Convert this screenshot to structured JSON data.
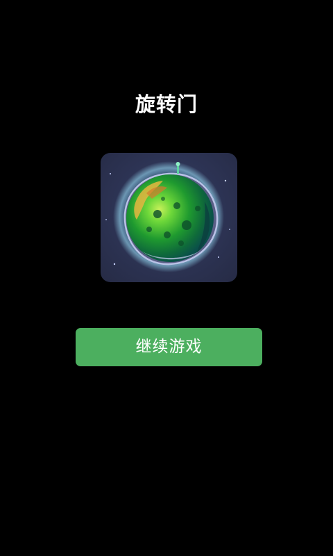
{
  "app": {
    "title": "旋转门"
  },
  "game_icon": {
    "icon": "green-planet-icon"
  },
  "actions": {
    "continue_label": "继续游戏"
  },
  "colors": {
    "background": "#000000",
    "button": "#4caf5f",
    "text": "#ffffff",
    "icon_background": "#2e3557"
  }
}
